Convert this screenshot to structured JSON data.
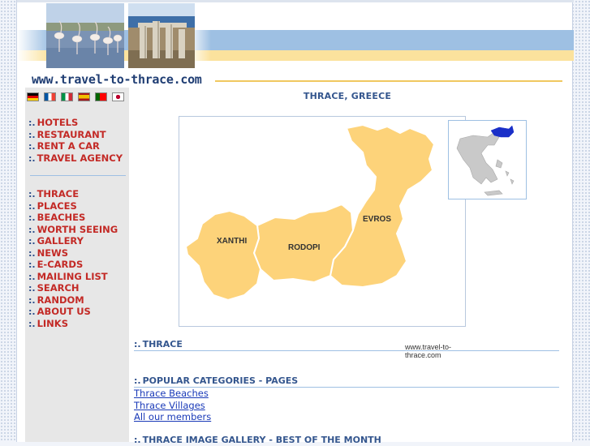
{
  "site": {
    "logo_text": "www.travel-to-thrace.com"
  },
  "languages": [
    {
      "code": "de",
      "icon": "german-flag-icon"
    },
    {
      "code": "fr",
      "icon": "french-flag-icon"
    },
    {
      "code": "it",
      "icon": "italian-flag-icon"
    },
    {
      "code": "es",
      "icon": "spanish-flag-icon"
    },
    {
      "code": "pt",
      "icon": "portuguese-flag-icon"
    },
    {
      "code": "jp",
      "icon": "japanese-flag-icon"
    }
  ],
  "sidebar": {
    "bullet": ":.",
    "group1": [
      "HOTELS",
      "RESTAURANT",
      "RENT A CAR",
      "TRAVEL AGENCY"
    ],
    "group2": [
      "THRACE",
      "PLACES",
      "BEACHES",
      "WORTH SEEING",
      "GALLERY",
      "NEWS",
      "E-CARDS",
      "MAILING LIST",
      "SEARCH",
      "RANDOM",
      "ABOUT US",
      "LINKS"
    ]
  },
  "main": {
    "title": "THRACE, GREECE",
    "map": {
      "regions": [
        "XANTHI",
        "RODOPI",
        "EVROS"
      ],
      "credit": "www.travel-to-thrace.com"
    },
    "sections": [
      {
        "bullet": ":.",
        "title": "THRACE"
      },
      {
        "bullet": ":.",
        "title": "POPULAR CATEGORIES - PAGES"
      },
      {
        "bullet": ":.",
        "title": "THRACE IMAGE GALLERY - BEST OF THE MONTH"
      }
    ],
    "links": [
      "Thrace Beaches",
      "Thrace Villages ",
      "All our members"
    ]
  },
  "colors": {
    "menu_text": "#c32a26",
    "heading_text": "#34568e",
    "link": "#1a3ab8",
    "map_fill": "#fdd37a",
    "sky_band": "#9ec0e3",
    "sand_band": "#fbe29d"
  }
}
